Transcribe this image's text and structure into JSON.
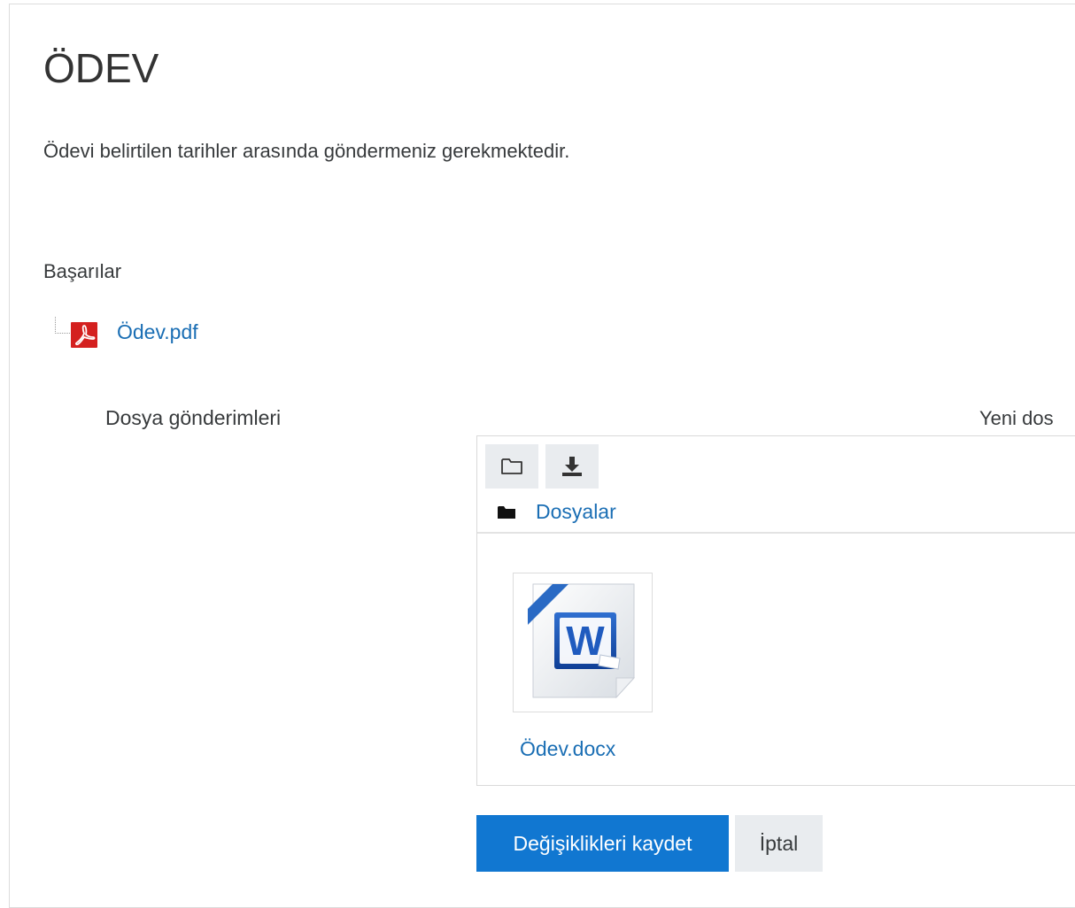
{
  "page": {
    "title": "ÖDEV",
    "intro": "Ödevi belirtilen tarihler arasında göndermeniz gerekmektedir.",
    "wish": "Başarılar"
  },
  "attachment": {
    "file_name": "Ödev.pdf",
    "icon": "pdf-icon",
    "icon_color": "#d4201f"
  },
  "form": {
    "submissions_label": "Dosya gönderimleri",
    "new_file_label": "Yeni dos"
  },
  "filemanager": {
    "toolbar": [
      {
        "name": "create-folder-button",
        "icon": "folder-outline-icon"
      },
      {
        "name": "download-button",
        "icon": "download-icon"
      }
    ],
    "breadcrumb_icon": "folder-solid-icon",
    "breadcrumb": "Dosyalar",
    "files": [
      {
        "name": "Ödev.docx",
        "icon": "word-document-icon"
      }
    ]
  },
  "actions": {
    "save_label": "Değişiklikleri kaydet",
    "cancel_label": "İptal"
  },
  "colors": {
    "link": "#1a6eb4",
    "primary": "#1177d1",
    "secondary_bg": "#e9ecef"
  }
}
